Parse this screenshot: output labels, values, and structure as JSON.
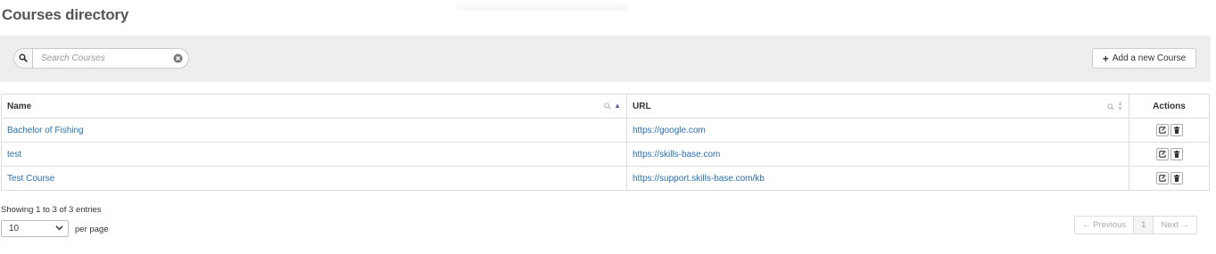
{
  "page": {
    "title": "Courses directory"
  },
  "toolbar": {
    "search": {
      "placeholder": "Search Courses",
      "value": ""
    },
    "add_button_label": "Add a new Course"
  },
  "table": {
    "columns": [
      {
        "label": "Name",
        "sort": "ascending",
        "searchable": true
      },
      {
        "label": "URL",
        "sort": "none",
        "searchable": true
      },
      {
        "label": "Actions"
      }
    ],
    "rows": [
      {
        "name": "Bachelor of Fishing",
        "url": "https://google.com"
      },
      {
        "name": "test",
        "url": "https://skills-base.com"
      },
      {
        "name": "Test Course",
        "url": "https://support.skills-base.com/kb"
      }
    ],
    "row_actions": [
      "edit-icon",
      "trash-icon"
    ]
  },
  "footer": {
    "info": "Showing 1 to 3 of 3 entries",
    "page_length": "10",
    "page_length_options": [
      "10"
    ],
    "per_page_label": "per page",
    "pagination": {
      "previous": "← Previous",
      "current": "1",
      "next": "Next →"
    }
  },
  "colors": {
    "link": "#2a6fb0",
    "toolbar_bg": "#eeeeee",
    "sort_active": "#6b5fb5"
  }
}
